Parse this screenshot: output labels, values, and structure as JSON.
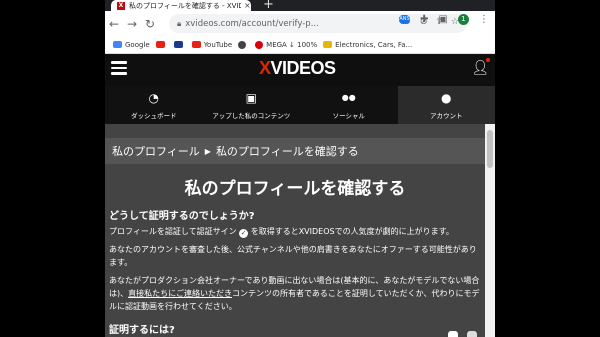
{
  "browser": {
    "tab_title": "私のプロフィールを確認する - XVIDEOS",
    "tab_close": "×",
    "new_tab": "+",
    "url": "xvideos.com/account/verify-p...",
    "profile_initial": "1",
    "ext_label": "ANS",
    "bookmarks": [
      {
        "label": "Google",
        "color": "#4285f4"
      },
      {
        "label": "",
        "color": "#e62117"
      },
      {
        "label": "",
        "color": "#1a3a8a"
      },
      {
        "label": "YouTube",
        "color": "#e62117"
      },
      {
        "label": "",
        "color": "#444444"
      },
      {
        "label": "MEGA ↓ 100%",
        "color": "#d90007"
      },
      {
        "label": "Electronics, Cars, Fa...",
        "color": "#e5b700"
      }
    ]
  },
  "site": {
    "logo_x": "X",
    "logo_rest": "VIDEOS",
    "nav_tabs": [
      {
        "label": "ダッシュボード",
        "icon": "dashboard-icon",
        "glyph": "◔"
      },
      {
        "label": "アップした私のコンテンツ",
        "icon": "upload-icon",
        "glyph": "▣"
      },
      {
        "label": "ソーシャル",
        "icon": "social-icon",
        "glyph": "●●"
      },
      {
        "label": "アカウント",
        "icon": "account-icon",
        "glyph": "●"
      }
    ]
  },
  "breadcrumb": {
    "parent": "私のプロフィール",
    "current": "私のプロフィールを確認する"
  },
  "page": {
    "title": "私のプロフィールを確認する",
    "section1_heading": "どうして証明するのでしょうか?",
    "p1_before": "プロフィールを認証して認証サイン",
    "p1_after": "を取得するとXVIDEOSでの人気度が劇的に上がります。",
    "p2": "あなたのアカウントを審査した後、公式チャンネルや他の肩書きをあなたにオファーする可能性があります。",
    "p3_a": "あなたがプロダクション会社オーナーであり動画に出ない場合は(基本的に、あなたがモデルでない場合は)、",
    "p3_link": "直接私たちにご連絡いただき",
    "p3_b": "コンテンツの所有者であることを証明していただくか、代わりにモデルに認証動画を行わせてください。",
    "section2_heading": "証明するには?"
  },
  "colors": {
    "brand_red": "#de2600",
    "content_bg": "#444444",
    "header_bg": "#0f0f0f"
  }
}
